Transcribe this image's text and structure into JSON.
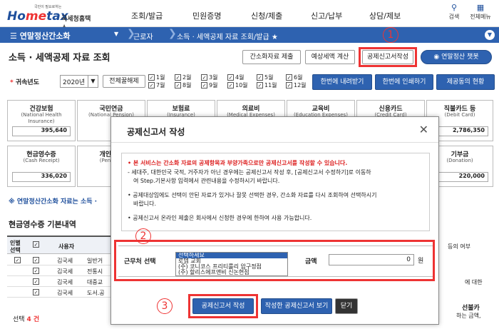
{
  "header": {
    "logo_small": "국민이 필요로하는",
    "logo_main_1": "Ho",
    "logo_main_2": "me",
    "logo_main_3": "tax",
    "logo_sub": "국세청홈택스",
    "nav": [
      "조회/발급",
      "민원증명",
      "신청/제출",
      "신고/납부",
      "상담/제보"
    ],
    "search_label": "검색",
    "menu_label": "전체메뉴"
  },
  "navbar": {
    "menu": "연말정산간소화",
    "crumb1": "근로자",
    "crumb2": "소득 · 세액공제 자료 조회/발급 ★"
  },
  "page": {
    "title": "소득 · 세액공제 자료 조회",
    "buttons": {
      "simple_submit": "간소화자료 제출",
      "estimate": "예상세액 계산",
      "deduction_form": "공제신고서작성",
      "chatbot": "연말정산 챗봇"
    },
    "year_label": "귀속년도",
    "year_star": "*",
    "year_value": "2020년",
    "select_all": "전체꿀해제",
    "months": [
      "1월",
      "2월",
      "3월",
      "4월",
      "5월",
      "6월",
      "7월",
      "8월",
      "9월",
      "10월",
      "11월",
      "12월"
    ],
    "download": "한번에 내려받기",
    "print": "한번에 인쇄하기",
    "provider_status": "제공동의 현황"
  },
  "cards": [
    {
      "t": "건강보험",
      "s": "(National Health Insurance)",
      "v": "395,640"
    },
    {
      "t": "국민연금",
      "s": "(National Pension)",
      "v": ""
    },
    {
      "t": "보험료",
      "s": "(Insurance)",
      "v": ""
    },
    {
      "t": "의료비",
      "s": "(Medical Expenses)",
      "v": ""
    },
    {
      "t": "교육비",
      "s": "(Education Expenses)",
      "v": ""
    },
    {
      "t": "신용카드",
      "s": "(Credit Card)",
      "v": ""
    },
    {
      "t": "직불카드 등",
      "s": "(Debit Card)",
      "v": "2,786,350"
    },
    {
      "t": "현금영수증",
      "s": "(Cash Receipt)",
      "v": "336,020"
    },
    {
      "t": "개인연금",
      "s": "(Pension)",
      "v": ""
    },
    {
      "t": "기부금",
      "s": "(Donation)",
      "v": "220,000"
    }
  ],
  "section": {
    "link": "※ 연말정산간소화 자료는 소득 ·",
    "sub_title": "현금영수증 기본내역",
    "grid_h1": "인별",
    "grid_h1b": "선택",
    "grid_h2": "사용자",
    "grid_h3": "일반거",
    "rows": [
      {
        "name": "김국세",
        "type": "일반거"
      },
      {
        "name": "김국세",
        "type": "전통시"
      },
      {
        "name": "김국세",
        "type": "대중교"
      },
      {
        "name": "김국세",
        "type": "도서.공"
      }
    ],
    "count_label": "선택",
    "count_value": "4 건",
    "right_frag1": "등의 여부",
    "right_frag2": "에 대한",
    "right_frag3": "선불카",
    "right_frag4": "하는 금액,"
  },
  "modal": {
    "title": "공제신고서 작성",
    "notice": [
      "• 본 서비스는 간소화 자료의 공제항목과 부양가족으로만 공제신고서를 작성할 수 있습니다.",
      "- 세대주, 대한민국 국적, 거주자가 아닌 경우에는 공제신고서 작성 후, [공제신고서 수정하기]로 이동하",
      "여 Step.기본사항 입력에서 관련내용을 수정하시기 바랍니다.",
      "• 공제대상임에도 선택이 안된 자료가 있거나 잘못 선택한 경우, 간소화 자료를 다시 조회하여 선택하시기",
      "바랍니다.",
      "• 공제신고서 온라인 제출은 회사에서 신청한 경우에 한하여 사용 가능합니다."
    ],
    "work_label": "근무처 선택",
    "work_options": [
      "선택하세요",
      "로뎀 교회",
      "(주) 코니코스 프리티룰리 압구정점",
      "(주) 할리스에프앤비 신논현점"
    ],
    "amount_label": "금액",
    "amount_value": "0",
    "amount_unit": "원",
    "btn_write": "공제신고서 작성",
    "btn_view": "작성한 공제신고서 보기",
    "btn_close": "닫기"
  },
  "markers": [
    "1",
    "2",
    "3"
  ],
  "colors": {
    "accent": "#2e62b0",
    "annotation": "#e33333"
  }
}
